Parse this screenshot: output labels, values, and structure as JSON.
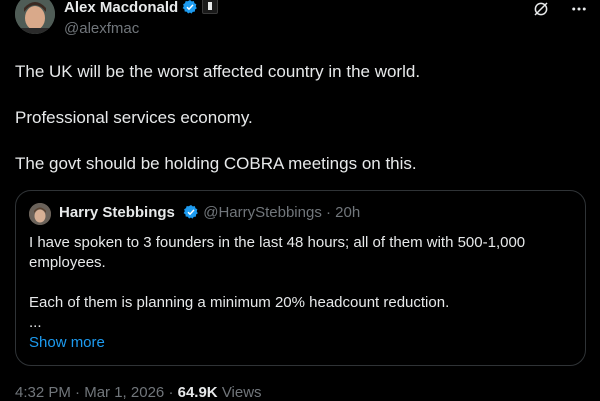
{
  "author": {
    "name": "Alex Macdonald",
    "handle": "@alexfmac",
    "verified": true
  },
  "top_icons": [
    "grok-icon",
    "more-icon"
  ],
  "tweet": {
    "text": "The UK will be the worst affected country in the world.\n\nProfessional services economy.\n\nThe govt should be holding COBRA meetings on this."
  },
  "quote": {
    "name": "Harry Stebbings",
    "handle": "@HarryStebbings",
    "separator": "·",
    "time": "20h",
    "text": "I have spoken to 3 founders in the last 48 hours; all of them with 500-1,000 employees.\n\nEach of them is planning a minimum 20% headcount reduction.\n...",
    "show_more": "Show more"
  },
  "meta": {
    "time": "4:32 PM",
    "dot1": "·",
    "date": "Mar 1, 2026",
    "dot2": "·",
    "views_count": "64.9K",
    "views_label": "Views"
  },
  "colors": {
    "background": "#000000",
    "text": "#e7e9ea",
    "secondary": "#71767b",
    "accent": "#1d9bf0",
    "border": "#2f3336"
  }
}
